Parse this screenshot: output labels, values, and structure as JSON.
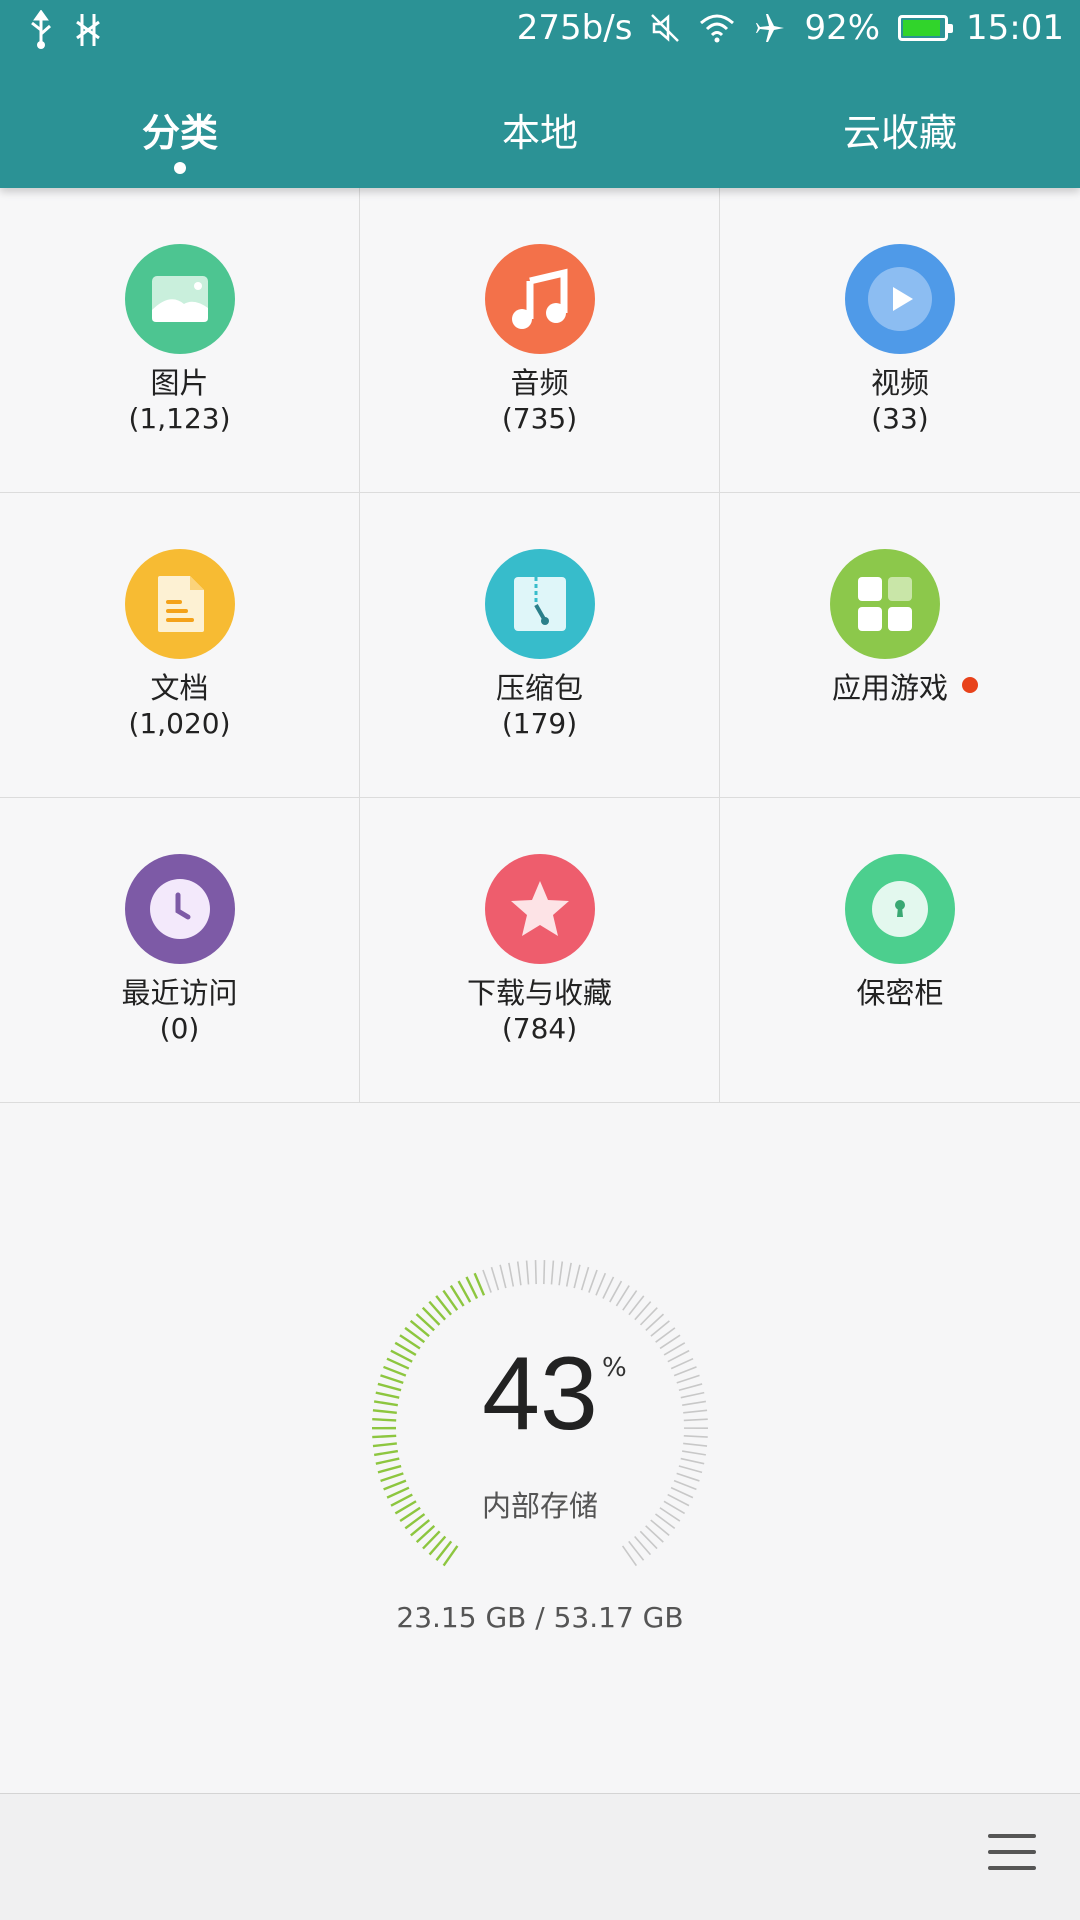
{
  "status_bar": {
    "net_speed": "275b/s",
    "battery_percent": "92%",
    "battery_level": 0.92,
    "time": "15:01",
    "icons": [
      "usb-icon",
      "usb-debug-icon",
      "mute-icon",
      "wifi-icon",
      "airplane-icon",
      "battery-icon"
    ]
  },
  "tabs": [
    {
      "label": "分类",
      "active": true
    },
    {
      "label": "本地",
      "active": false
    },
    {
      "label": "云收藏",
      "active": false
    }
  ],
  "categories": [
    {
      "label": "图片",
      "count": "(1,123)",
      "icon": "image-icon",
      "color": "#4dc591"
    },
    {
      "label": "音频",
      "count": "(735)",
      "icon": "music-icon",
      "color": "#f3714a"
    },
    {
      "label": "视频",
      "count": "(33)",
      "icon": "video-icon",
      "color": "#4f9ae8"
    },
    {
      "label": "文档",
      "count": "(1,020)",
      "icon": "document-icon",
      "color": "#f7bb33"
    },
    {
      "label": "压缩包",
      "count": "(179)",
      "icon": "zip-icon",
      "color": "#37bccb"
    },
    {
      "label": "应用游戏",
      "count": "",
      "icon": "apps-icon",
      "color": "#8cc84b",
      "badge_color": "#e8421b"
    },
    {
      "label": "最近访问",
      "count": "(0)",
      "icon": "clock-icon",
      "color": "#7d5aa6"
    },
    {
      "label": "下载与收藏",
      "count": "(784)",
      "icon": "star-icon",
      "color": "#ee5d6d"
    },
    {
      "label": "保密柜",
      "count": "",
      "icon": "lock-icon",
      "color": "#4ccf8e"
    }
  ],
  "storage": {
    "percent": "43",
    "percent_sign": "%",
    "used_fraction": 0.43,
    "label": "内部存储",
    "usage": "23.15 GB / 53.17 GB",
    "used_color": "#8dc63f",
    "unused_color": "#c8c8c8"
  },
  "bottom_bar": {
    "menu_icon": "menu-icon"
  }
}
